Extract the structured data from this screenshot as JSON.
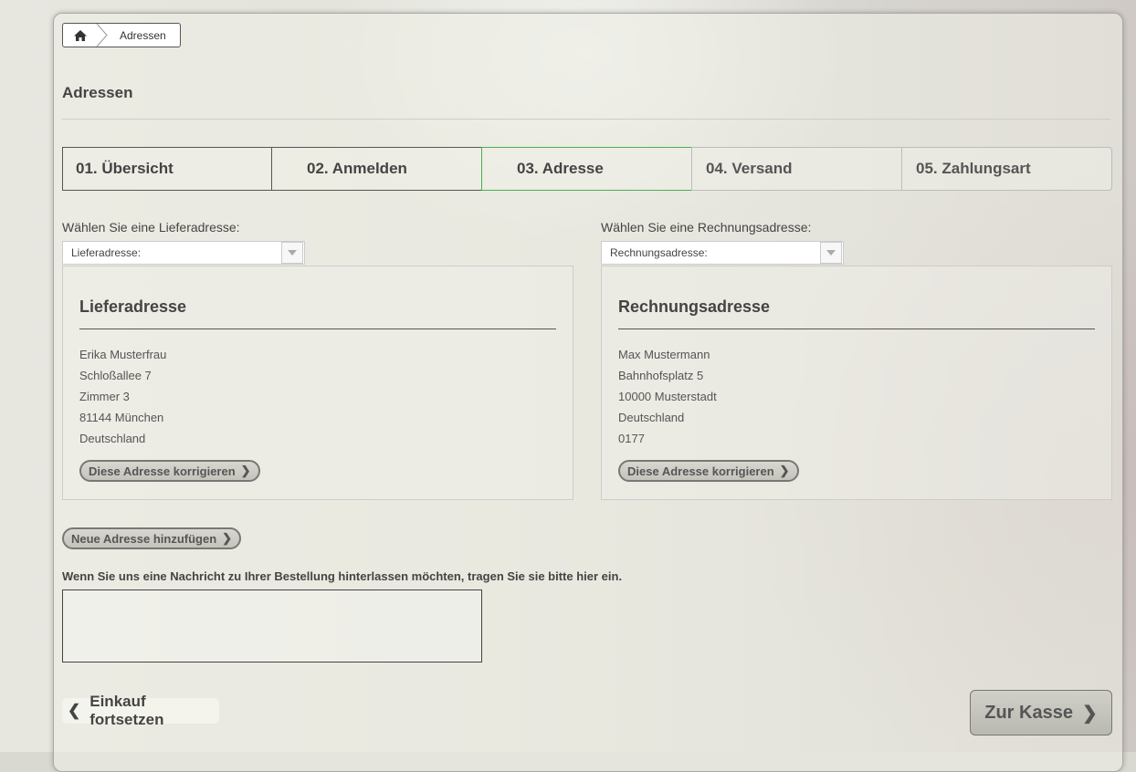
{
  "breadcrumb": {
    "home_icon": "home-icon",
    "current": "Adressen"
  },
  "page": {
    "title": "Adressen"
  },
  "steps": [
    {
      "label": "01. Übersicht",
      "state": "done"
    },
    {
      "label": "02. Anmelden",
      "state": "done"
    },
    {
      "label": "03. Adresse",
      "state": "active"
    },
    {
      "label": "04. Versand",
      "state": "future"
    },
    {
      "label": "05. Zahlungsart",
      "state": "future"
    }
  ],
  "shipping": {
    "choose_label": "Wählen Sie eine Lieferadresse:",
    "select_value": "Lieferadresse:",
    "box_title": "Lieferadresse",
    "lines": [
      "Erika Musterfrau",
      "Schloßallee 7",
      "Zimmer 3",
      "81144 München",
      "Deutschland"
    ],
    "edit_button": "Diese Adresse korrigieren"
  },
  "billing": {
    "choose_label": "Wählen Sie eine Rechnungsadresse:",
    "select_value": "Rechnungsadresse:",
    "box_title": "Rechnungsadresse",
    "lines": [
      "Max Mustermann",
      "Bahnhofsplatz 5",
      "10000 Musterstadt",
      "Deutschland",
      "0177"
    ],
    "edit_button": "Diese Adresse korrigieren"
  },
  "add_address_button": "Neue Adresse hinzufügen",
  "message": {
    "label": "Wenn Sie uns eine Nachricht zu Ihrer Bestellung hinterlassen möchten, tragen Sie sie bitte hier ein.",
    "value": ""
  },
  "footer": {
    "continue_shopping": "Einkauf fortsetzen",
    "checkout": "Zur Kasse"
  },
  "colors": {
    "active_step_border": "#4caf50",
    "text": "#444444"
  }
}
